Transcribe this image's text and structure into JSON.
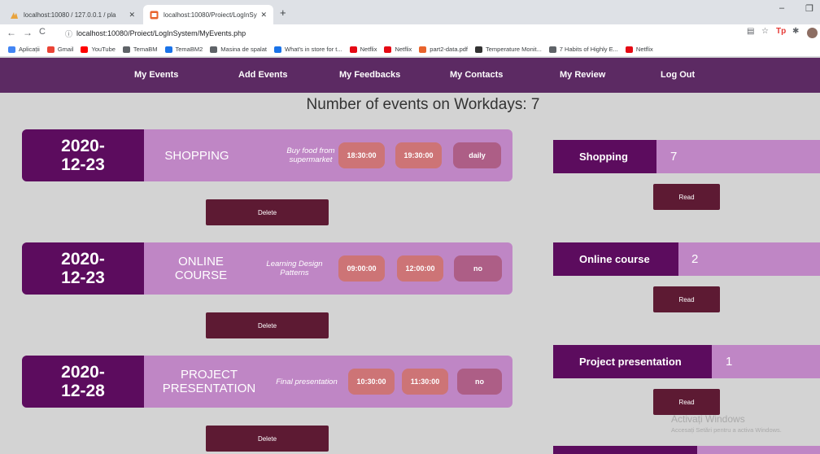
{
  "browser": {
    "tabs": [
      {
        "title": "localhost:10080 / 127.0.0.1 / pla",
        "favicon_color": "#e8a33d"
      },
      {
        "title": "localhost:10080/Proiect/LogInSy",
        "favicon_color": "#e8632c"
      }
    ],
    "new_tab_symbol": "+",
    "close_symbol": "✕",
    "url": "localhost:10080/Proiect/LogInSystem/MyEvents.php",
    "bookmarks": [
      {
        "label": "Aplicații",
        "icon": "apps-grid-icon",
        "color": "#4285f4"
      },
      {
        "label": "Gmail",
        "icon": "gmail-icon",
        "color": "#ea4335"
      },
      {
        "label": "YouTube",
        "icon": "youtube-icon",
        "color": "#ff0000"
      },
      {
        "label": "TemaBM",
        "icon": "globe-icon",
        "color": "#5f6368"
      },
      {
        "label": "TemaBM2",
        "icon": "cloud-icon",
        "color": "#1a73e8"
      },
      {
        "label": "Masina de spalat",
        "icon": "globe-icon",
        "color": "#5f6368"
      },
      {
        "label": "What's in store for t...",
        "icon": "news-icon",
        "color": "#1a73e8"
      },
      {
        "label": "Netflix",
        "icon": "netflix-icon",
        "color": "#e50914"
      },
      {
        "label": "Netflix",
        "icon": "netflix-icon",
        "color": "#e50914"
      },
      {
        "label": "part2-data.pdf",
        "icon": "pdf-icon",
        "color": "#e8632c"
      },
      {
        "label": "Temperature Monit...",
        "icon": "monitor-icon",
        "color": "#333333"
      },
      {
        "label": "7 Habits of Highly E...",
        "icon": "globe-icon",
        "color": "#5f6368"
      },
      {
        "label": "Netflix",
        "icon": "netflix-icon",
        "color": "#e50914"
      }
    ]
  },
  "nav": {
    "items": [
      "My Events",
      "Add Events",
      "My Feedbacks",
      "My Contacts",
      "My Review",
      "Log Out"
    ]
  },
  "heading": "Number of events on Workdays: 7",
  "events": [
    {
      "date": "2020-\n12-23",
      "title": "SHOPPING",
      "description": "Buy food from supermarket",
      "start": "18:30:00",
      "end": "19:30:00",
      "repeat": "daily",
      "delete_label": "Delete"
    },
    {
      "date": "2020-\n12-23",
      "title": "ONLINE\nCOURSE",
      "description": "Learning Design Patterns",
      "start": "09:00:00",
      "end": "12:00:00",
      "repeat": "no",
      "delete_label": "Delete"
    },
    {
      "date": "2020-\n12-28",
      "title": "PROJECT\nPRESENTATION",
      "description": "Final presentation",
      "start": "10:30:00",
      "end": "11:30:00",
      "repeat": "no",
      "delete_label": "Delete"
    }
  ],
  "contacts": [
    {
      "name": "Shopping",
      "count": "7",
      "read_label": "Read"
    },
    {
      "name": "Online course",
      "count": "2",
      "read_label": "Read"
    },
    {
      "name": "Project presentation",
      "count": "1",
      "read_label": "Read"
    }
  ],
  "watermark": {
    "title": "Activați Windows",
    "subtitle": "Accesați Setări pentru a activa Windows."
  },
  "colors": {
    "nav_bg": "#5c2a63",
    "card_bg": "#bf86c5",
    "date_bg": "#5c0c5e",
    "time_pill": "#cd7476",
    "repeat_pill": "#ad5e86",
    "button_bg": "#5d1a33"
  }
}
